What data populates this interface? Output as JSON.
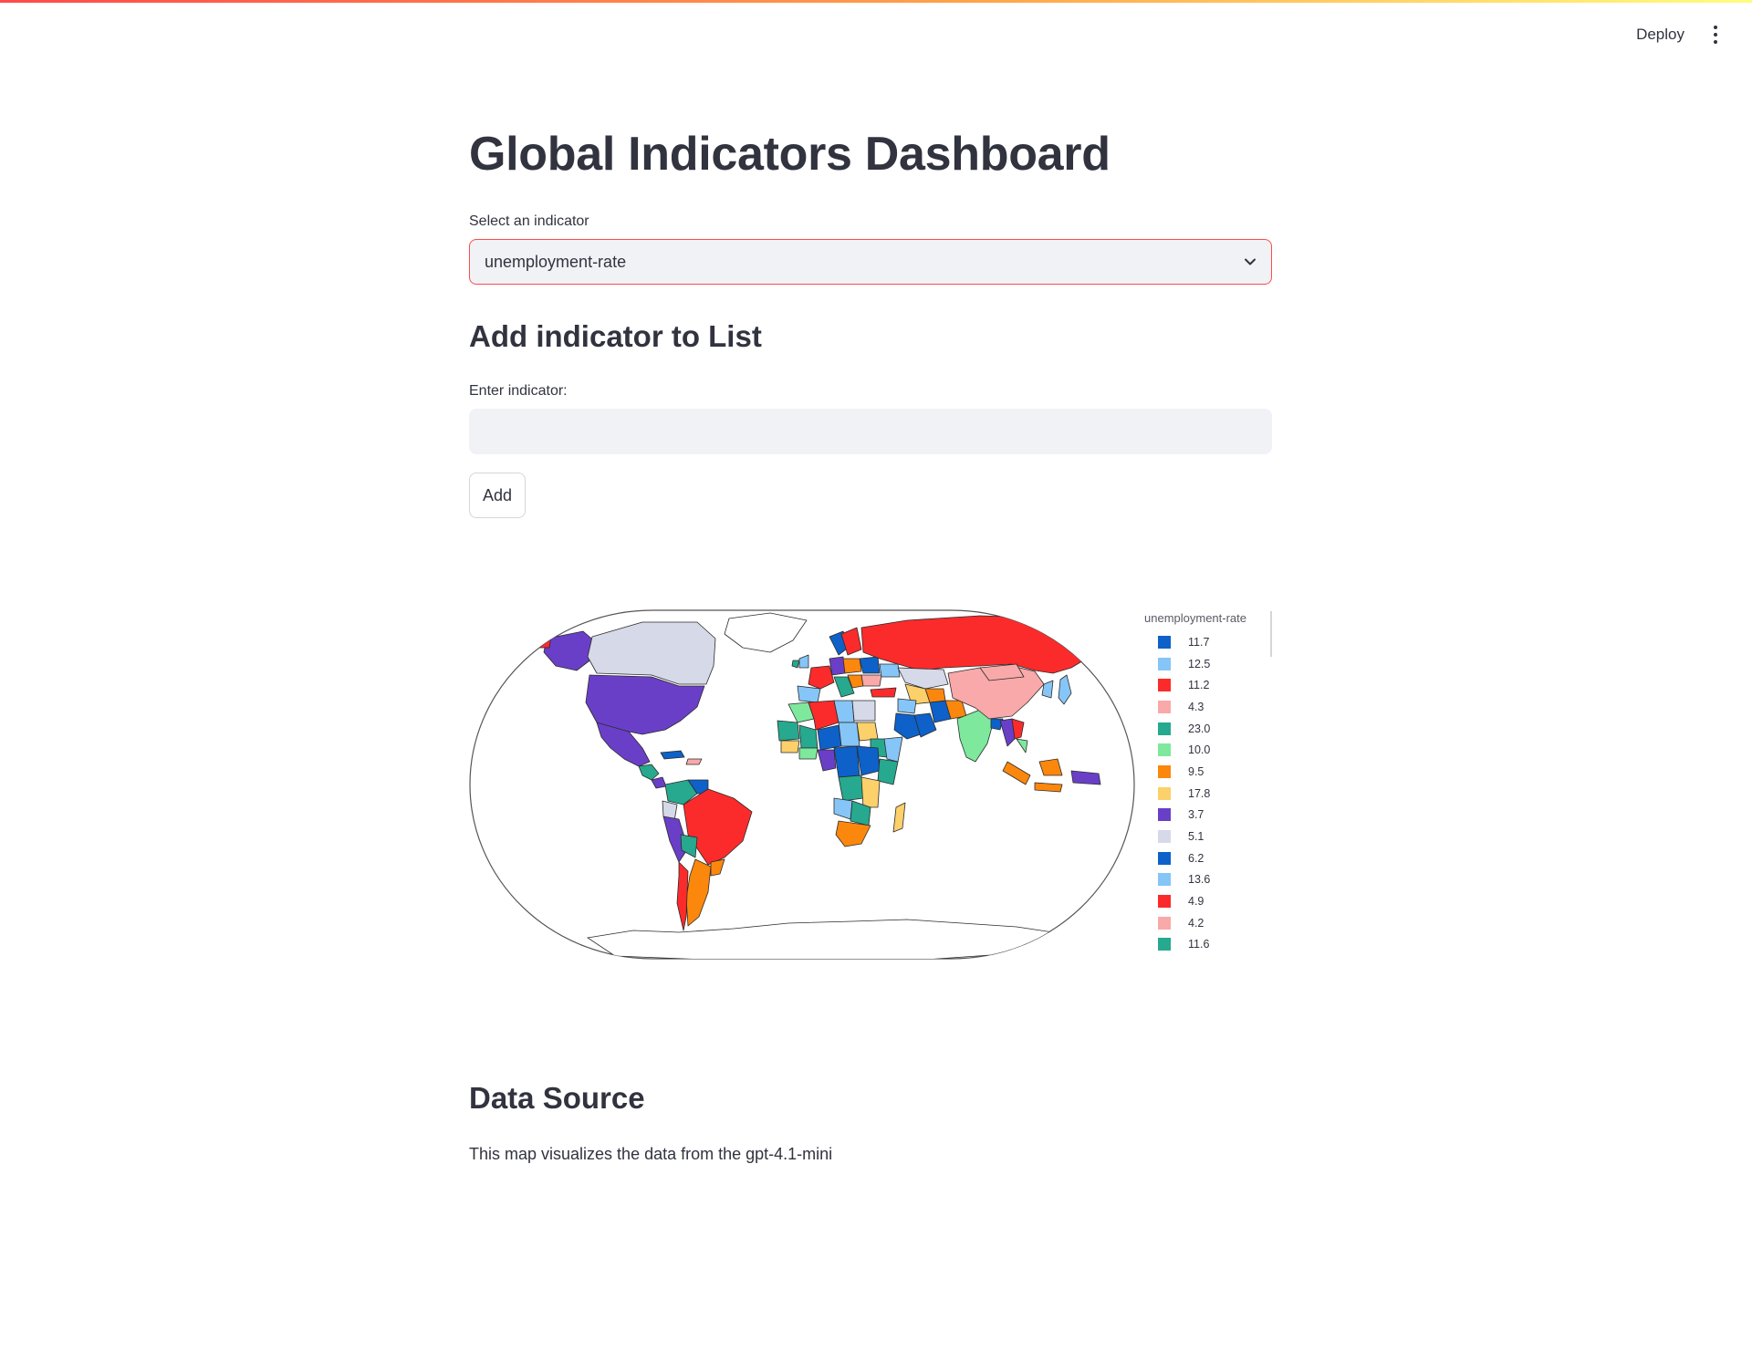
{
  "header": {
    "deploy_label": "Deploy",
    "menu_icon": "kebab-menu-icon"
  },
  "main": {
    "title": "Global Indicators Dashboard",
    "select_label": "Select an indicator",
    "select_value": "unemployment-rate",
    "add_heading": "Add indicator to List",
    "input_label": "Enter indicator:",
    "input_value": "",
    "add_button": "Add"
  },
  "chart_data": {
    "type": "choropleth",
    "legend_title": "unemployment-rate",
    "legend_position": "right",
    "projection": "natural-earth",
    "series": [
      {
        "name": "11.7",
        "color": "#0d61c9"
      },
      {
        "name": "12.5",
        "color": "#86c5f7"
      },
      {
        "name": "11.2",
        "color": "#fc2b2b"
      },
      {
        "name": "4.3",
        "color": "#f9a9a9"
      },
      {
        "name": "23.0",
        "color": "#26a98e"
      },
      {
        "name": "10.0",
        "color": "#7ee89d"
      },
      {
        "name": "9.5",
        "color": "#fc870d"
      },
      {
        "name": "17.8",
        "color": "#fcd06a"
      },
      {
        "name": "3.7",
        "color": "#6a3fc7"
      },
      {
        "name": "5.1",
        "color": "#d5d9e8"
      },
      {
        "name": "6.2",
        "color": "#0d61c9"
      },
      {
        "name": "13.6",
        "color": "#86c5f7"
      },
      {
        "name": "4.9",
        "color": "#fc2b2b"
      },
      {
        "name": "4.2",
        "color": "#f9a9a9"
      },
      {
        "name": "11.6",
        "color": "#26a98e"
      }
    ]
  },
  "data_source": {
    "heading": "Data Source",
    "text": "This map visualizes the data from the gpt-4.1-mini"
  }
}
